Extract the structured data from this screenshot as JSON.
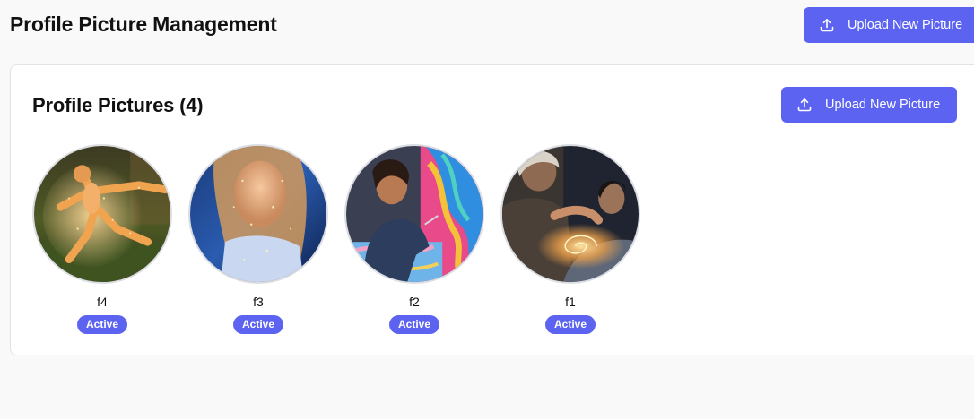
{
  "page": {
    "title": "Profile Picture Management",
    "upload_label": "Upload New Picture"
  },
  "card": {
    "title": "Profile Pictures (4)",
    "upload_label": "Upload New Picture"
  },
  "pictures": [
    {
      "name": "f4",
      "status": "Active"
    },
    {
      "name": "f3",
      "status": "Active"
    },
    {
      "name": "f2",
      "status": "Active"
    },
    {
      "name": "f1",
      "status": "Active"
    }
  ],
  "colors": {
    "accent": "#5b63f0",
    "background": "#f9f9fa",
    "card": "#ffffff",
    "border": "#e3e3e6"
  },
  "icons": {
    "upload": "upload-icon"
  }
}
